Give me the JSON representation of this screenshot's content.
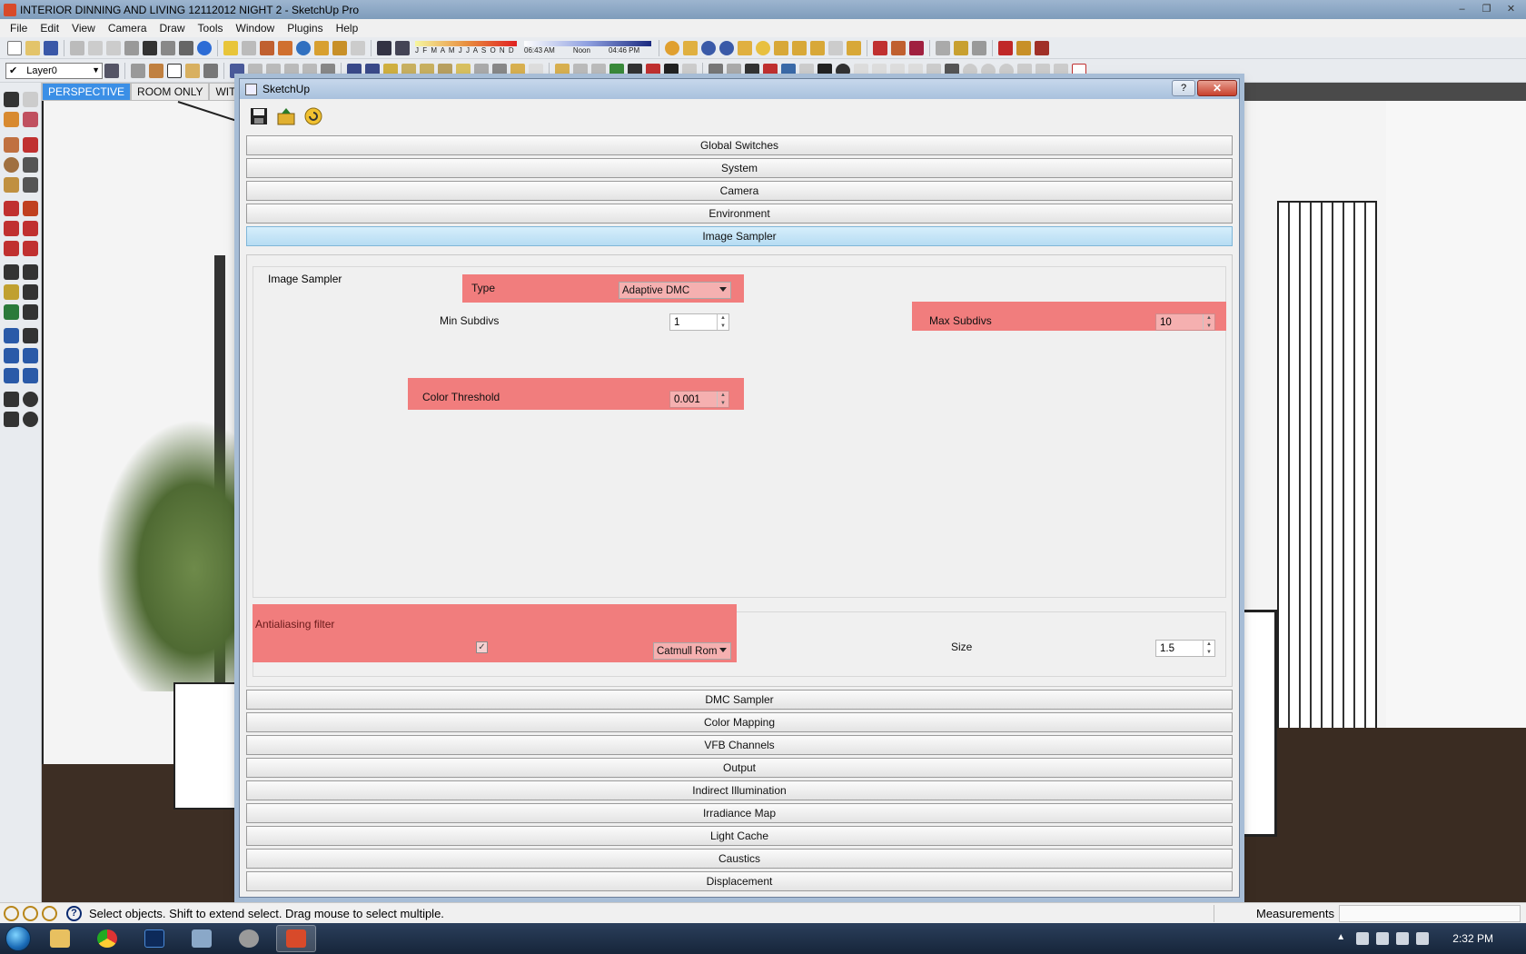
{
  "window": {
    "title": "INTERIOR DINNING AND LIVING 12112012 NIGHT 2 - SketchUp Pro",
    "controls": [
      "–",
      "❐",
      "✕"
    ]
  },
  "menu": [
    "File",
    "Edit",
    "View",
    "Camera",
    "Draw",
    "Tools",
    "Window",
    "Plugins",
    "Help"
  ],
  "layer": {
    "name": "Layer0",
    "checked": "✔"
  },
  "shadow": {
    "months": "J F M A M J J A S O N D",
    "time_start": "06:43 AM",
    "time_mid": "Noon",
    "time_end": "04:46 PM"
  },
  "scene_tabs": [
    {
      "label": "PERSPECTIVE",
      "active": true
    },
    {
      "label": "ROOM ONLY",
      "active": false
    },
    {
      "label": "WITHOU",
      "active": false
    }
  ],
  "dialog": {
    "title": "SketchUp",
    "help_label": "?",
    "close_label": "✕",
    "sections_top": [
      "Global Switches",
      "System",
      "Camera",
      "Environment",
      "Image Sampler"
    ],
    "active_section": "Image Sampler",
    "sections_bottom": [
      "DMC Sampler",
      "Color Mapping",
      "VFB Channels",
      "Output",
      "Indirect Illumination",
      "Irradiance Map",
      "Light Cache",
      "Caustics",
      "Displacement"
    ],
    "image_sampler": {
      "group_title": "Image Sampler",
      "type_label": "Type",
      "type_value": "Adaptive DMC",
      "min_subdivs_label": "Min Subdivs",
      "min_subdivs_value": "1",
      "max_subdivs_label": "Max Subdivs",
      "max_subdivs_value": "10",
      "color_threshold_label": "Color Threshold",
      "color_threshold_value": "0.001",
      "aa_label": "Antialiasing filter",
      "aa_checked": "✓",
      "aa_filter_value": "Catmull Rom",
      "size_label": "Size",
      "size_value": "1.5"
    }
  },
  "status": {
    "message": "Select objects. Shift to extend select. Drag mouse to select multiple.",
    "measurements_label": "Measurements",
    "help_glyph": "?"
  },
  "taskbar": {
    "clock": "2:32 PM"
  },
  "colors": {
    "highlight": "#f17d7d",
    "active_tab": "#3b8fe6",
    "active_section": "#b6dcf3"
  }
}
